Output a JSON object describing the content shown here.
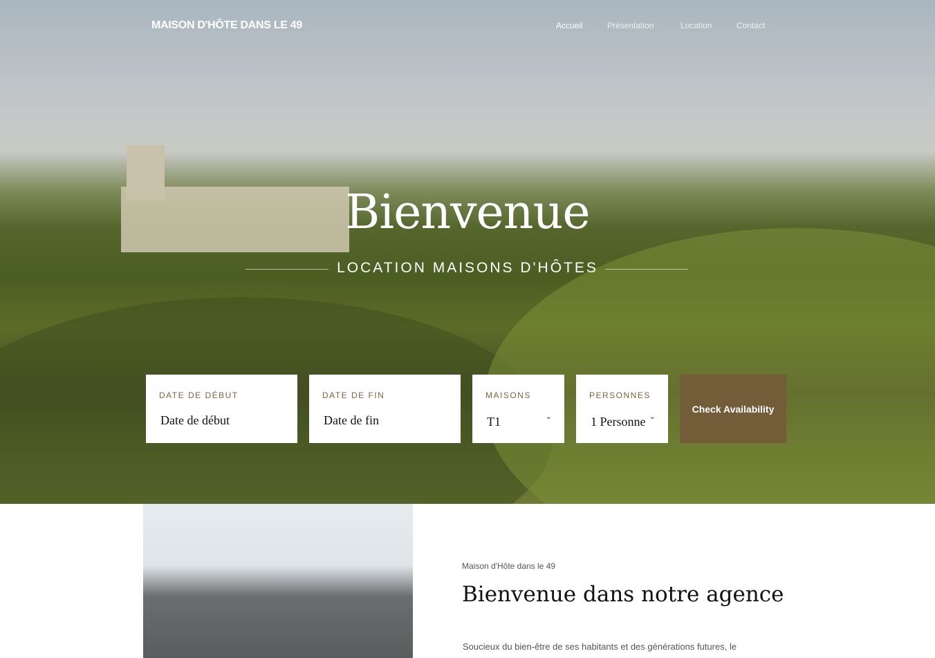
{
  "header": {
    "logo": "MAISON D'HÔTE DANS LE 49",
    "nav": [
      "Accueil",
      "Présentation",
      "Location",
      "Contact"
    ]
  },
  "hero": {
    "title": "Bienvenue",
    "subtitle": "LOCATION MAISONS D'HÔTES"
  },
  "booking": {
    "start": {
      "label": "DATE DE DÉBUT",
      "placeholder": "Date de début"
    },
    "end": {
      "label": "DATE DE FIN",
      "placeholder": "Date de fin"
    },
    "houses": {
      "label": "MAISONS",
      "value": "T1"
    },
    "people": {
      "label": "PERSONNES",
      "value": "1 Personne"
    },
    "button": "Check Availability",
    "accent": "#735c38"
  },
  "intro": {
    "eyebrow": "Maison d'Hôte dans le 49",
    "title": "Bienvenue dans notre agence",
    "text": "Soucieux du bien-être de ses habitants et des générations futures, le"
  }
}
